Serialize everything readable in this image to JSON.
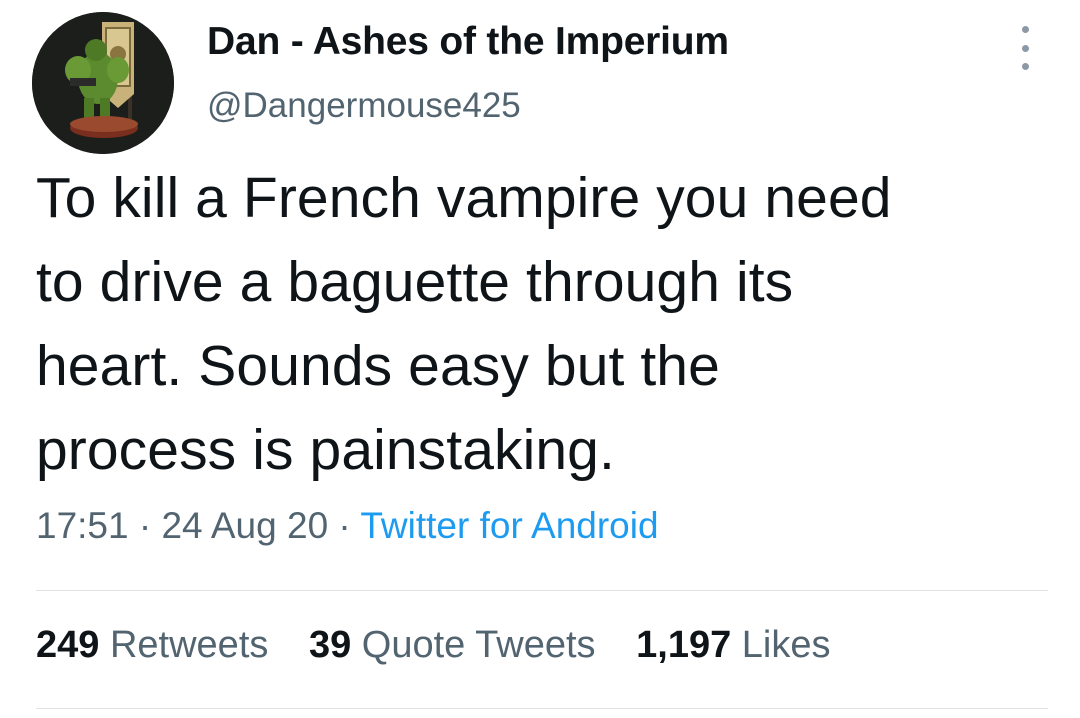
{
  "author": {
    "display_name": "Dan - Ashes of the Imperium",
    "handle": "@Dangermouse425"
  },
  "tweet": {
    "lines": [
      "To kill a French vampire you need",
      "to drive a baguette through its",
      "heart. Sounds easy but the",
      "process is painstaking."
    ]
  },
  "meta": {
    "time": "17:51",
    "separator": " · ",
    "date": "24 Aug 20",
    "source": "Twitter for Android"
  },
  "stats": {
    "retweets_count": "249",
    "retweets_label": "Retweets",
    "quotes_count": "39",
    "quotes_label": "Quote Tweets",
    "likes_count": "1,197",
    "likes_label": "Likes"
  },
  "colors": {
    "link": "#1d9bf0",
    "secondary_text": "#536471",
    "primary_text": "#0f1419"
  },
  "icons": {
    "more": "more-vertical-icon",
    "avatar": "space-marine-miniature-avatar"
  }
}
